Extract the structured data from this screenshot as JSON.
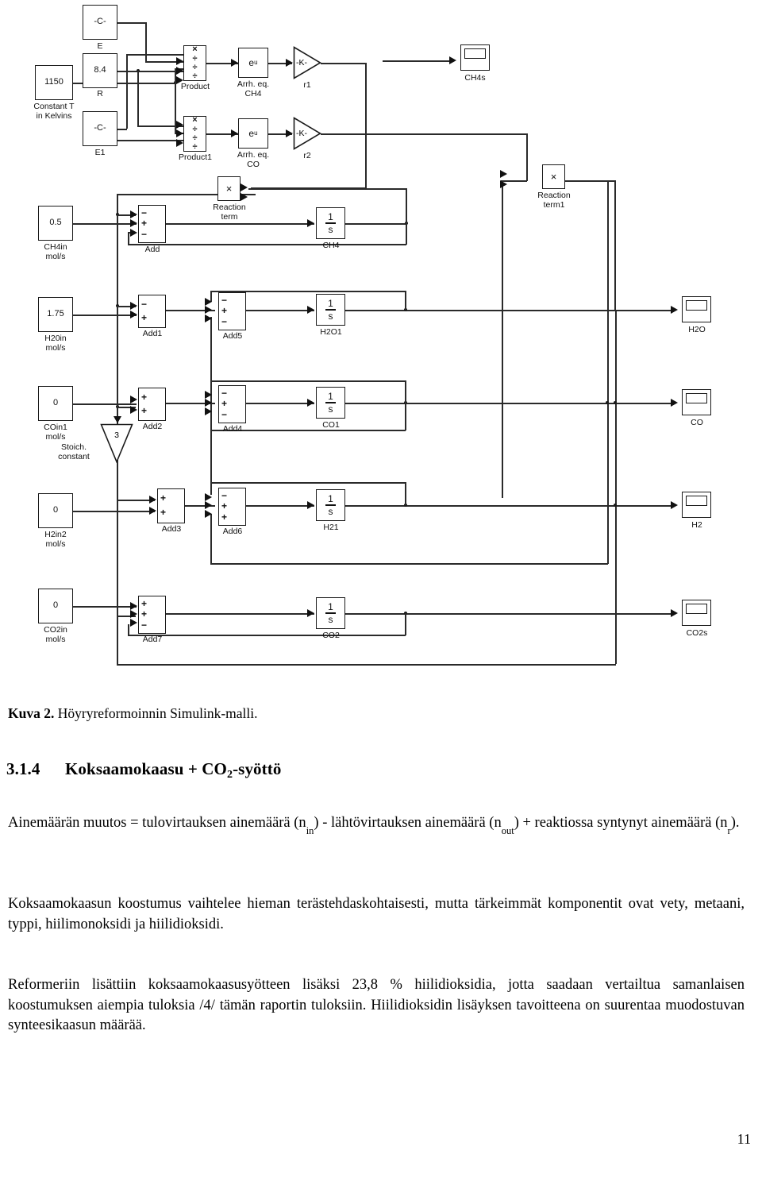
{
  "figure": {
    "caption_label": "Kuva 2.",
    "caption_text": " Höyryreformoinnin Simulink-malli.",
    "blocks": {
      "const_E": {
        "value": "-C-",
        "label": "E"
      },
      "const_R": {
        "value": "8.4",
        "label": "R"
      },
      "const_T": {
        "value": "1150",
        "label": "Constant T\nin Kelvins"
      },
      "const_E1": {
        "value": "-C-",
        "label": "E1"
      },
      "product": {
        "label": "Product"
      },
      "product1": {
        "label": "Product1"
      },
      "arrh_ch4": {
        "value": "e",
        "exponent": "u",
        "label": "Arrh. eq.\nCH4"
      },
      "arrh_co": {
        "value": "e",
        "exponent": "u",
        "label": "Arrh. eq.\nCO"
      },
      "gain_r1": {
        "value": "-K-",
        "label": "r1"
      },
      "gain_r2": {
        "value": "-K-",
        "label": "r2"
      },
      "scope_ch4s": {
        "label": "CH4s"
      },
      "scope_h2o": {
        "label": "H2O"
      },
      "scope_co": {
        "label": "CO"
      },
      "scope_h2": {
        "label": "H2"
      },
      "scope_co2s": {
        "label": "CO2s"
      },
      "reaction_term": {
        "value": "×",
        "label": "Reaction\nterm"
      },
      "reaction_term1": {
        "value": "×",
        "label": "Reaction\nterm1"
      },
      "ch4in": {
        "value": "0.5",
        "label": "CH4in\nmol/s"
      },
      "h2oin": {
        "value": "1.75",
        "label": "H20in\nmol/s"
      },
      "coin1": {
        "value": "0",
        "label": "COin1\nmol/s"
      },
      "h2in2": {
        "value": "0",
        "label": "H2in2\nmol/s"
      },
      "co2in": {
        "value": "0",
        "label": "CO2in\nmol/s"
      },
      "stoich": {
        "value": "3",
        "label": "Stoich.\nconstant"
      },
      "add": {
        "signs": "−+−",
        "label": "Add"
      },
      "add1": {
        "signs": "−+",
        "label": "Add1"
      },
      "add2": {
        "signs": "++",
        "label": "Add2"
      },
      "add3": {
        "signs": "++",
        "label": "Add3"
      },
      "add4": {
        "signs": "−+−",
        "label": "Add4"
      },
      "add5": {
        "signs": "−+−",
        "label": "Add5"
      },
      "add6": {
        "signs": "−++",
        "label": "Add6"
      },
      "add7": {
        "signs": "++−",
        "label": "Add7"
      },
      "int_ch4": {
        "num": "1",
        "den": "s",
        "label": "CH4"
      },
      "int_h2o1": {
        "num": "1",
        "den": "s",
        "label": "H2O1"
      },
      "int_co1": {
        "num": "1",
        "den": "s",
        "label": "CO1"
      },
      "int_h21": {
        "num": "1",
        "den": "s",
        "label": "H21"
      },
      "int_co2": {
        "num": "1",
        "den": "s",
        "label": "CO2"
      }
    }
  },
  "section": {
    "number": "3.1.4",
    "title_a": "Koksaamokaasu + CO",
    "title_sub": "2",
    "title_b": "-syöttö"
  },
  "paragraphs": {
    "p1_a": "Ainemäärän muutos = tulovirtauksen ainemäärä (n",
    "p1_sub1": "in",
    "p1_b": ") - lähtövirtauksen ainemäärä (n",
    "p1_sub2": "out",
    "p1_c": ") + reaktiossa syntynyt ainemäärä (n",
    "p1_sub3": "r",
    "p1_d": ").",
    "p2": "Koksaamokaasun koostumus vaihtelee hieman terästehdaskohtaisesti, mutta tärkeimmät komponentit ovat vety, metaani, typpi, hiilimonoksidi ja hiilidioksidi.",
    "p3": "Reformeriin lisättiin koksaamokaasusyötteen lisäksi 23,8 % hiilidioksidia, jotta saadaan vertailtua samanlaisen koostumuksen aiempia tuloksia /4/ tämän raportin tuloksiin. Hiilidioksidin lisäyksen tavoitteena on suurentaa muodostuvan synteesikaasun määrää."
  },
  "page_number": "11"
}
